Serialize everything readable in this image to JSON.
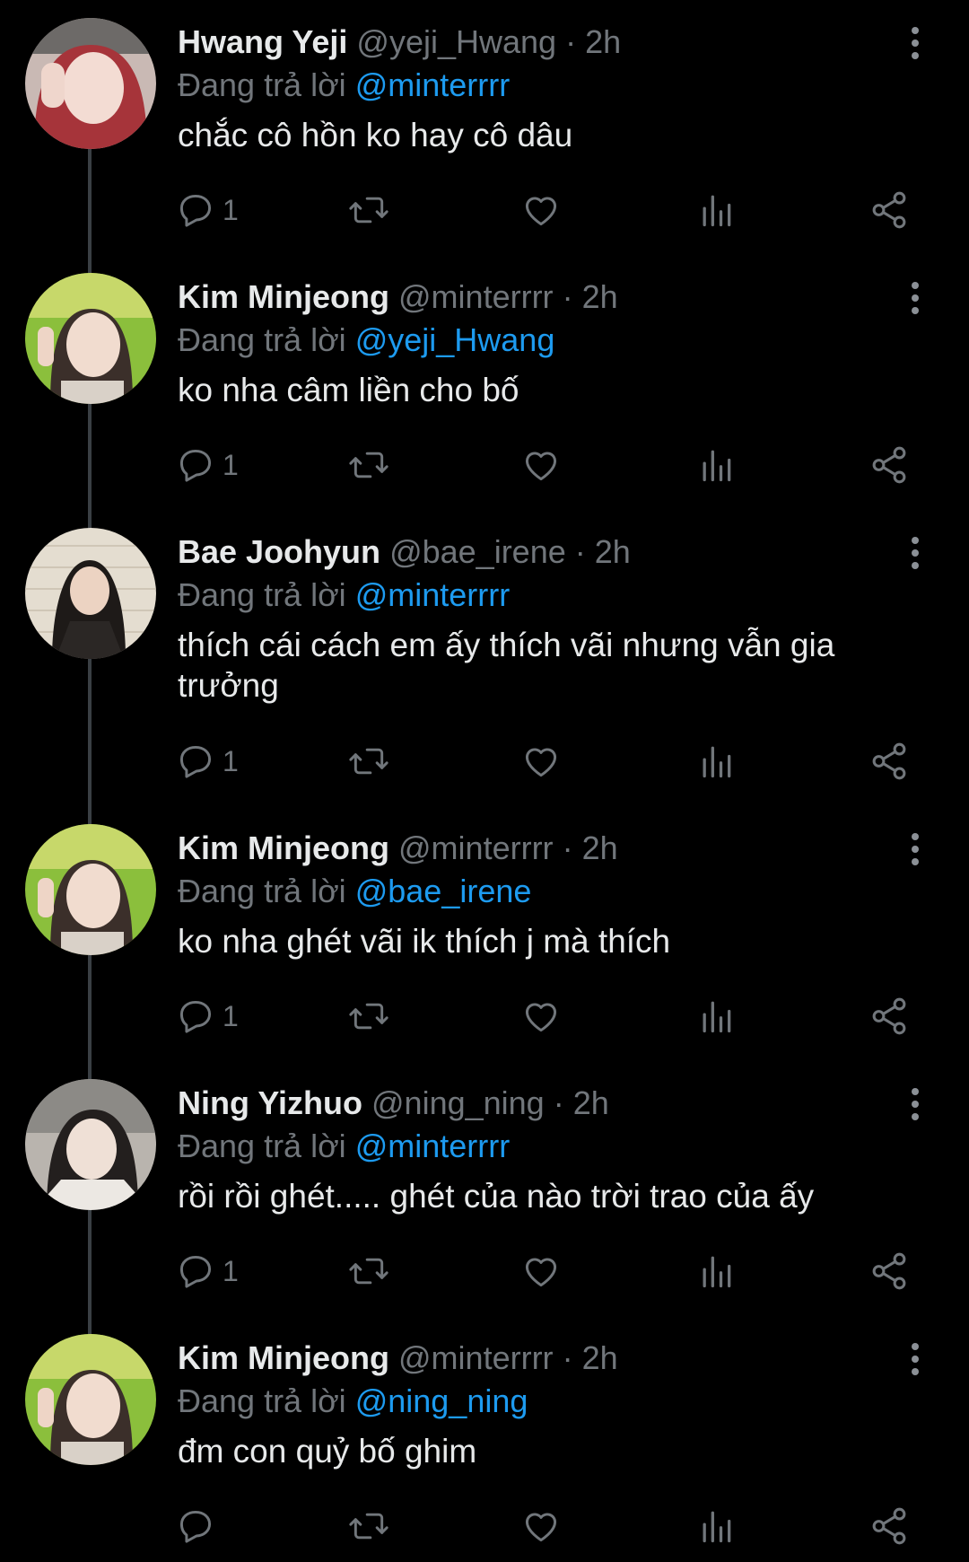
{
  "thread": {
    "replying_prefix": "Đang trả lời",
    "tweets": [
      {
        "name": "Hwang Yeji",
        "handle": "@yeji_Hwang",
        "separator": "·",
        "time": "2h",
        "reply_to": "@minterrrr",
        "text": "chắc cô hồn ko hay cô dâu",
        "reply_count": "1"
      },
      {
        "name": "Kim Minjeong",
        "handle": "@minterrrr",
        "separator": "·",
        "time": "2h",
        "reply_to": "@yeji_Hwang",
        "text": "ko nha câm liền cho bố",
        "reply_count": "1"
      },
      {
        "name": "Bae Joohyun",
        "handle": "@bae_irene",
        "separator": "·",
        "time": "2h",
        "reply_to": "@minterrrr",
        "text": "thích cái cách em ấy thích vãi nhưng vẫn gia trưởng",
        "reply_count": "1"
      },
      {
        "name": "Kim Minjeong",
        "handle": "@minterrrr",
        "separator": "·",
        "time": "2h",
        "reply_to": "@bae_irene",
        "text": "ko nha ghét vãi ik thích j mà thích",
        "reply_count": "1"
      },
      {
        "name": "Ning Yizhuo",
        "handle": "@ning_ning",
        "separator": "·",
        "time": "2h",
        "reply_to": "@minterrrr",
        "text": "rồi rồi ghét..... ghét của nào trời trao của ấy",
        "reply_count": "1"
      },
      {
        "name": "Kim Minjeong",
        "handle": "@minterrrr",
        "separator": "·",
        "time": "2h",
        "reply_to": "@ning_ning",
        "text": "đm con quỷ bố ghim",
        "reply_count": ""
      }
    ]
  },
  "icons": [
    "reply-icon",
    "retweet-icon",
    "like-icon",
    "views-icon",
    "share-icon",
    "more-icon"
  ],
  "colors": {
    "background": "#000000",
    "text": "#e7e9ea",
    "secondary": "#71767b",
    "link": "#1d9bf0",
    "thread_line": "#3a3f44"
  }
}
